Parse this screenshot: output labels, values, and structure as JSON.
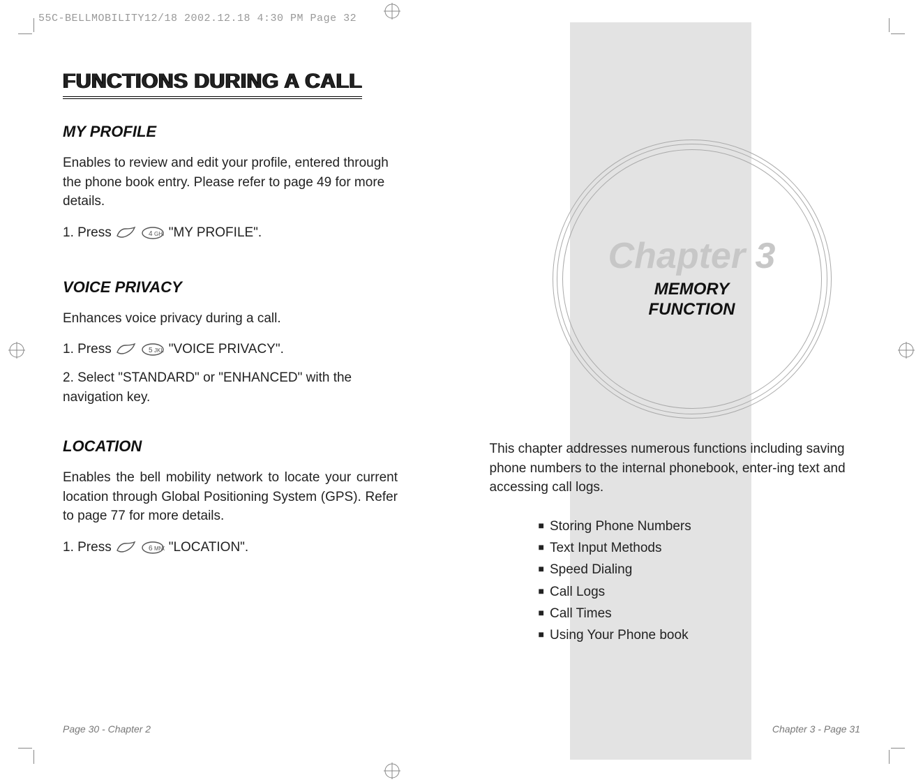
{
  "print_header": "55C-BELLMOBILITY12/18  2002.12.18  4:30 PM  Page 32",
  "left": {
    "title": "FUNCTIONS DURING A CALL",
    "sections": [
      {
        "heading": "MY PROFILE",
        "body": "Enables to review and edit your profile, entered through the phone book entry. Please refer to page 49 for more details.",
        "steps": [
          {
            "prefix": "1. Press",
            "key": "4",
            "suffix": "\"MY PROFILE\"."
          }
        ]
      },
      {
        "heading": "VOICE PRIVACY",
        "body": "Enhances voice privacy during a call.",
        "steps": [
          {
            "prefix": "1. Press",
            "key": "5",
            "suffix": "\"VOICE PRIVACY\"."
          },
          {
            "text": "2. Select \"STANDARD\" or \"ENHANCED\" with the navigation key."
          }
        ]
      },
      {
        "heading": "LOCATION",
        "body": "Enables the bell mobility network to locate your current location through Global Positioning System (GPS). Refer to page 77 for more details.",
        "steps": [
          {
            "prefix": "1. Press",
            "key": "6",
            "suffix": "\"LOCATION\"."
          }
        ]
      }
    ],
    "footer": "Page 30 - Chapter 2"
  },
  "right": {
    "chapter_title": "Chapter 3",
    "chapter_sub_line1": "MEMORY",
    "chapter_sub_line2": "FUNCTION",
    "desc": "This chapter addresses numerous functions including saving phone numbers to the internal phonebook, enter-ing text and accessing call logs.",
    "bullets": [
      "Storing Phone Numbers",
      "Text Input Methods",
      "Speed Dialing",
      "Call Logs",
      "Call Times",
      "Using Your Phone book"
    ],
    "footer": "Chapter 3 - Page 31"
  }
}
